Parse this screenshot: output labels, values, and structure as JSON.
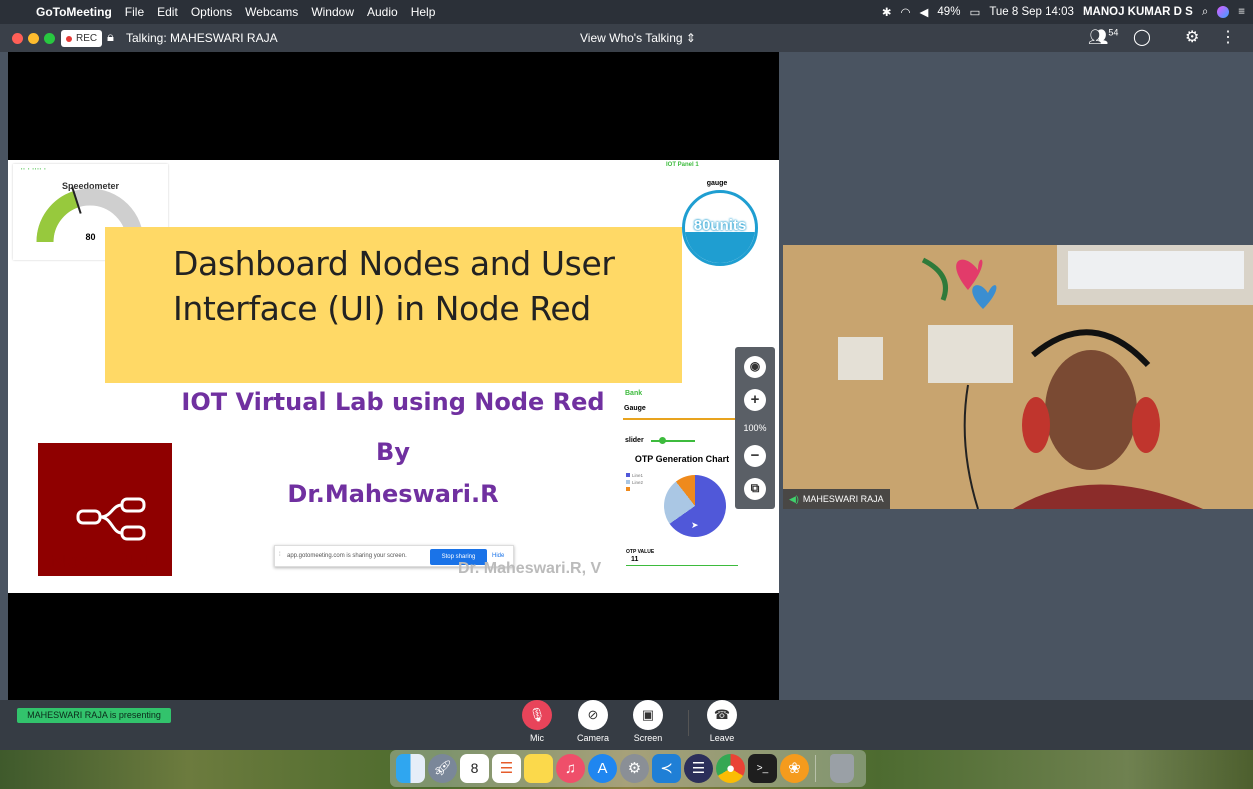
{
  "menubar": {
    "apple": "",
    "app": "GoToMeeting",
    "items": [
      "File",
      "Edit",
      "Options",
      "Webcams",
      "Window",
      "Audio",
      "Help"
    ],
    "battery": "49%",
    "datetime": "Tue 8 Sep 14:03",
    "user": "MANOJ KUMAR D S"
  },
  "toolbar": {
    "rec_label": "REC",
    "talking": "Talking: MAHESWARI RAJA",
    "view_label": "View Who's Talking",
    "attendee_count": "54"
  },
  "slide": {
    "speedometer_label": "Speedometer",
    "speedometer_value": "80",
    "speedometer_fraction": 0.4,
    "iot_panel_title": "IOT Panel 1",
    "gauge_label": "gauge",
    "gauge_value": "80units",
    "title": "Dashboard Nodes and User Interface (UI) in Node Red",
    "subtitle_1": "IOT Virtual Lab using Node Red",
    "subtitle_2": "By",
    "subtitle_3": "Dr.Maheswari.R",
    "node_red_label": "Node-RED",
    "bank_title": "Bank",
    "bank_gauge": "Gauge",
    "bank_slider": "slider",
    "otp_chart_title": "OTP Generation Chart",
    "legend": [
      "Line1",
      "Line2"
    ],
    "otp_label": "OTP VALUE",
    "otp_value": "11",
    "watermark": "Dr. Maheswari.R, V",
    "share_text": "app.gotomeeting.com is sharing your screen.",
    "stop_sharing": "Stop sharing",
    "hide": "Hide"
  },
  "zoom": {
    "percent": "100%"
  },
  "video": {
    "name": "MAHESWARI RAJA"
  },
  "controls": {
    "presenting": "MAHESWARI RAJA is presenting",
    "mic": "Mic",
    "camera": "Camera",
    "screen": "Screen",
    "leave": "Leave"
  },
  "dock": {
    "apps": [
      "finder-icon",
      "launchpad-icon",
      "calendar-icon",
      "reminders-icon",
      "notes-icon",
      "music-icon",
      "app-store-icon",
      "system-preferences-icon",
      "vscode-icon",
      "eclipse-icon",
      "chrome-icon",
      "terminal-icon",
      "gotomeeting-icon",
      "trash-icon"
    ],
    "calendar_day": "8"
  },
  "colors": {
    "accent_green": "#32c36c",
    "mic_muted": "#e8445a",
    "banner_yellow": "#ffd966",
    "subtitle_purple": "#7030a0",
    "node_red": "#8f0000"
  }
}
